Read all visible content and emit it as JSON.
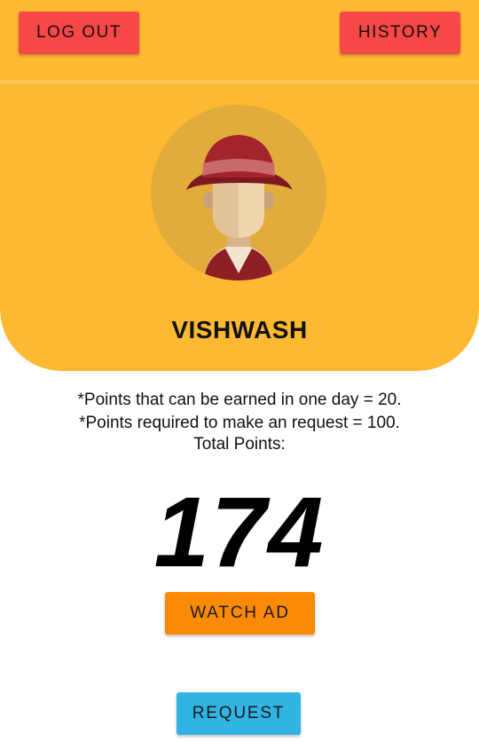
{
  "header": {
    "logout_label": "LOG OUT",
    "history_label": "HISTORY",
    "username": "VISHWASH"
  },
  "info": {
    "line1": "*Points that can be earned in one day = 20.",
    "line2": "*Points required to make an request = 100.",
    "line3": "Total Points:"
  },
  "points": {
    "total": "174"
  },
  "actions": {
    "watch_ad_label": "WATCH AD",
    "request_label": "REQUEST"
  },
  "colors": {
    "header_bg": "#fdb932",
    "top_buttons": "#f74848",
    "watch_ad_button": "#fb8a06",
    "request_button": "#31b4e4"
  },
  "icons": {
    "avatar": "user-avatar-hat-icon"
  }
}
